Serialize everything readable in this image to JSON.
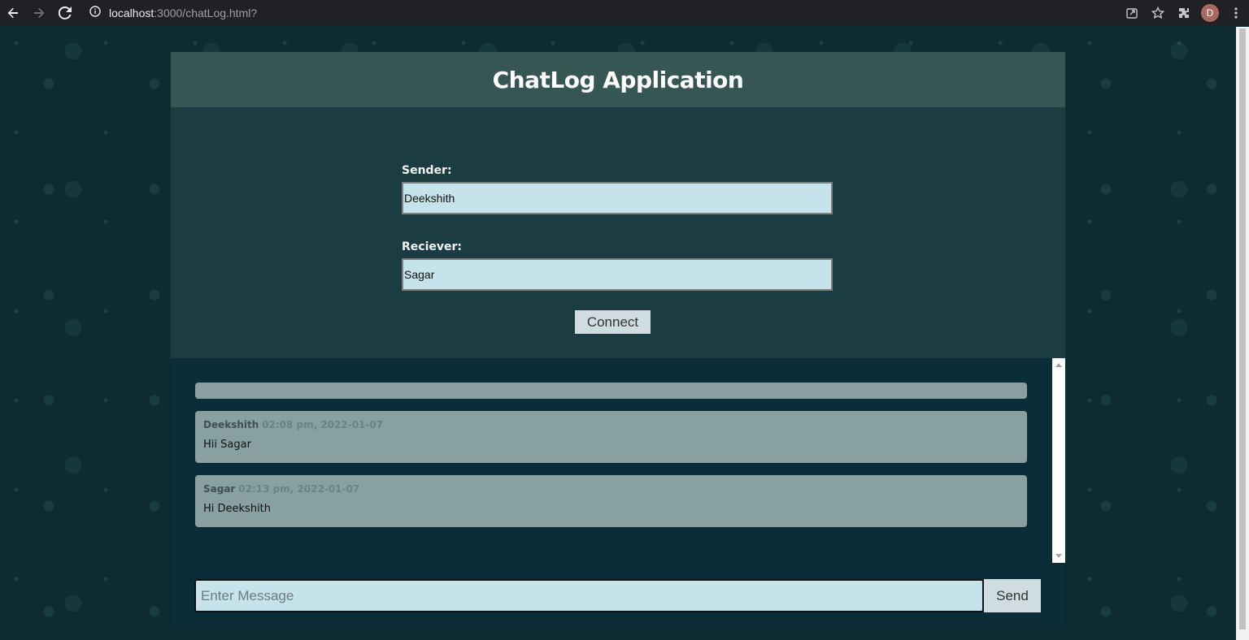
{
  "browser": {
    "url_host": "localhost",
    "url_path": ":3000/chatLog.html?",
    "avatar_letter": "D",
    "icons": [
      "back-icon",
      "forward-icon",
      "reload-icon",
      "info-icon",
      "share-icon",
      "star-icon",
      "extensions-icon",
      "menu-icon"
    ]
  },
  "app": {
    "title": "ChatLog Application",
    "sender_label": "Sender:",
    "sender_value": "Deekshith",
    "receiver_label": "Reciever:",
    "receiver_value": "Sagar",
    "connect_label": "Connect"
  },
  "chat": {
    "messages": [
      {
        "sender": "Deekshith",
        "time": "02:08 pm, 2022-01-07",
        "text": "Hii Sagar"
      },
      {
        "sender": "Sagar",
        "time": "02:13 pm, 2022-01-07",
        "text": "Hi Deekshith"
      }
    ],
    "input_placeholder": "Enter Message",
    "send_label": "Send"
  },
  "colors": {
    "page_bg": "#0d2b30",
    "header_bg": "#365656",
    "card_bg": "#1b3d42",
    "chat_bg": "#0b2d37",
    "bubble_bg": "#88a0a0",
    "input_bg": "#c4e3ea"
  }
}
